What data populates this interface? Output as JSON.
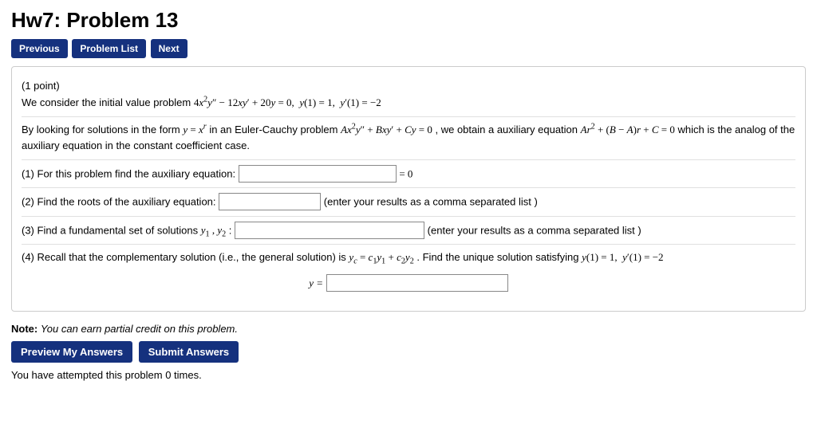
{
  "header": {
    "title": "Hw7: Problem 13"
  },
  "nav": {
    "previous": "Previous",
    "problem_list": "Problem List",
    "next": "Next"
  },
  "problem": {
    "points_label": "(1 point)",
    "intro_line": "We consider the initial value problem ",
    "ivp_math": "4x²y″ − 12xy′ + 20y = 0,   y(1) = 1,   y′(1) = −2",
    "paragraph_a": "By looking for solutions in the form ",
    "form_math": "y = xʳ",
    "paragraph_b": " in an Euler-Cauchy problem ",
    "ec_math": "Ax²y″ + Bxy′ + Cy = 0",
    "paragraph_c": ", we obtain a auxiliary equation ",
    "aux_math": "Ar² + (B − A)r + C = 0",
    "paragraph_d": " which is the analog of the auxiliary equation in the constant coefficient case.",
    "q1_label": "(1) For this problem find the auxiliary equation:",
    "q1_suffix": "= 0",
    "q2_label": "(2) Find the roots of the auxiliary equation:",
    "q2_hint": "(enter your results as a comma separated list )",
    "q3_label": "(3) Find a fundamental set of solutions ",
    "q3_sub": "y₁ , y₂",
    "q3_colon": ":",
    "q3_hint": "(enter your results as a comma separated list )",
    "q4_label_a": "(4) Recall that the complementary solution (i.e., the general solution) is ",
    "q4_math": "y_c = c₁y₁ + c₂y₂",
    "q4_label_b": ". Find the unique solution satisfying ",
    "q4_cond": "y(1) = 1,   y′(1) = −2",
    "y_eq": "y ="
  },
  "footer": {
    "note_bold": "Note:",
    "note_text": " You can earn partial credit on this problem.",
    "preview_btn": "Preview My Answers",
    "submit_btn": "Submit Answers",
    "attempts": "You have attempted this problem 0 times."
  }
}
